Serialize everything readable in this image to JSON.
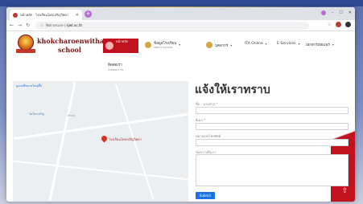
{
  "browser": {
    "tab_title": "หน้าหลัก - โรงเรียนโคกเจริญวิทยา",
    "tab_close": "✕",
    "new_tab": "+",
    "url_prefix": "Not secure |",
    "url_host": "kjwt.ac.th",
    "controls": [
      "–",
      "☐",
      "✕"
    ]
  },
  "site": {
    "brand_line1": "khokcharoenwithaya",
    "brand_line2": "school",
    "menu_home": {
      "label": "หน้าหลัก",
      "sub": "HOME"
    },
    "menu_items": [
      {
        "label": "ข้อมูลโรงเรียน",
        "sub": "ABOUT SCHOOL"
      },
      {
        "label": "บุคลากร"
      },
      {
        "label": "ITA Online"
      },
      {
        "label": "E-Services"
      },
      {
        "label": "เอกสารเผยแพร่"
      }
    ],
    "submenu": {
      "label": "ติดต่อเรา",
      "sub": "CONTACT US"
    }
  },
  "map": {
    "link": "ดูแผนที่ขนาดใหญ่ขึ้น",
    "label1": "วัดโคกเจริญ",
    "label2": "ตำบล",
    "pin_label": "โรงเรียนโคกเจริญวิทยา"
  },
  "form": {
    "title": "แจ้งให้เราทราบ",
    "name_label": "ชื่อ - นามสกุล *",
    "email_label": "อีเมล *",
    "phone_label": "หมายเลขโทรศัพท์",
    "message_label": "ข้อความถึงเรา",
    "submit": "Submit"
  },
  "colors": {
    "brand_red": "#c1121f",
    "brand_text": "#7a1313",
    "link_blue": "#1a73e8"
  }
}
